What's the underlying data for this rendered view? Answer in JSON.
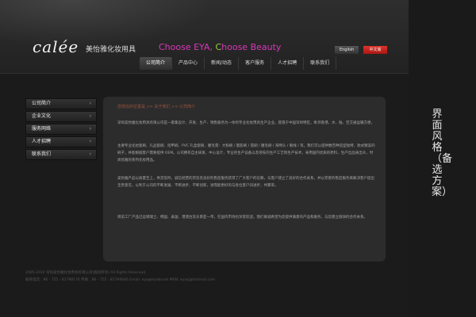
{
  "header": {
    "logo": "calée",
    "brand": "美怡雅化妆用具",
    "slogan_part1": "Choose EYA, ",
    "slogan_part2": "C",
    "slogan_part3": "hoose Beauty",
    "lang_en": "English",
    "lang_cn": "中文版"
  },
  "nav": {
    "items": [
      "公司简介",
      "产品中心",
      "新闻/动态",
      "客户服务",
      "人才招聘",
      "联系我们"
    ]
  },
  "sidebar": {
    "items": [
      "公司简介",
      "企业文化",
      "服务网络",
      "人才招聘",
      "联系我们"
    ],
    "arrow": "›"
  },
  "content": {
    "breadcrumb": "您现在的位置是 >> 关于我们 >> 公司简介",
    "paragraphs": [
      "深圳美怡雅化妆用具有限公司是一家集设计、开发、生产、销售服务为一体的专业化妆用具生产企业。座落于中国深圳特区，毗邻香港，水、陆、空交通运输方便。",
      "主要专业化妆套刷、礼品套刷、指甲刷、PVC 礼盒套刷、睫毛膏：大粉刷 / 腮影刷 / 唇刷 / 睫毛刷 / 海绵头 / 眼线 / 等，我们可以提供数百种造型独特、款式精美的刷子，并能根据客户需要提供 OEM。公司拥有自主研发、中心设计，专业的生产设备以及领先的生产工艺和生产技术，采用国内优质的原料，生产出品质出众，时尚优雅的系列化妆用品。",
      "美怡雅产品以质量至上，供货及时，诚信经营的宗旨及良好的售后服务获得了广大客户的信赖，与客户建立了良好的合作关系，并以完善的售后服务来解决客户提出宝贵意见，以利于公司的不断发展、不断进步、不断创新，进而能更好的与各位客户同进步，共繁荣。",
      "目前工厂产品已远销瑞士、韩国、泰国、港澳台及东南亚一带，在国内市场也深受欢迎。我们真诚希望为您提供满意的产品和服务，与您建立愉快的合作关系。"
    ]
  },
  "footer": {
    "line1": "2005-2010 深圳美怡雅化妆用具有限公司(版权所有) All Rights Reserved.",
    "line2": "联系电话：86 - 755 - 81798176  传真：86 - 755 - 81794646  Email: eya@eyabrush  MSN: eyasj@hotmail.com"
  },
  "side_title": "界面风格（备选方案）",
  "colors": {
    "accent_pink": "#d838b8",
    "accent_green": "#9bd03a",
    "lang_cn_red": "#c9241d",
    "background": "#1b1b1b"
  }
}
